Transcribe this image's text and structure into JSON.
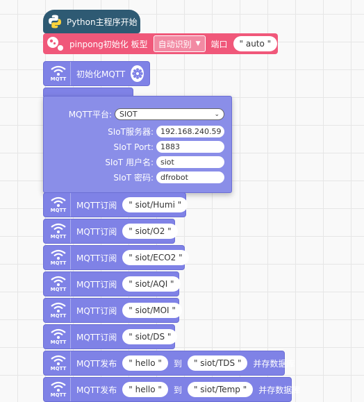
{
  "colors": {
    "mqtt_block": "#7f82e6",
    "hat_block": "#2e5a73",
    "pingpong_block": "#f0587a",
    "canvas": "#f9f9f9"
  },
  "hat": {
    "label": "Python主程序开始",
    "icon": "python-icon"
  },
  "pingpong": {
    "label_init": "pinpong初始化 板型",
    "board_value": "自动识别",
    "port_label": "端口",
    "port_value": "\" auto \""
  },
  "mqtt_init": {
    "label": "初始化MQTT",
    "icon_text": "MQTT",
    "settings_icon": "gear-icon"
  },
  "panel": {
    "platform_label": "MQTT平台:",
    "platform_value": "SIOT",
    "server_label": "SIoT服务器:",
    "server_value": "192.168.240.59",
    "port_label": "SIoT Port:",
    "port_value": "1883",
    "user_label": "SIoT 用户名:",
    "user_value": "siot",
    "password_label": "SIoT 密码:",
    "password_value": "dfrobot"
  },
  "subscribe_blocks": [
    {
      "label": "MQTT订阅",
      "topic": "\" siot/Humi \""
    },
    {
      "label": "MQTT订阅",
      "topic": "\" siot/O2 \""
    },
    {
      "label": "MQTT订阅",
      "topic": "\" siot/ECO2 \""
    },
    {
      "label": "MQTT订阅",
      "topic": "\" siot/AQI \""
    },
    {
      "label": "MQTT订阅",
      "topic": "\" siot/MOI \""
    },
    {
      "label": "MQTT订阅",
      "topic": "\" siot/DS \""
    }
  ],
  "publish_blocks": [
    {
      "label": "MQTT发布",
      "message": "\" hello \"",
      "to": "到",
      "topic": "\" siot/TDS \"",
      "suffix": "并存数据库"
    },
    {
      "label": "MQTT发布",
      "message": "\" hello \"",
      "to": "到",
      "topic": "\" siot/Temp \"",
      "suffix": "并存数据库"
    }
  ]
}
